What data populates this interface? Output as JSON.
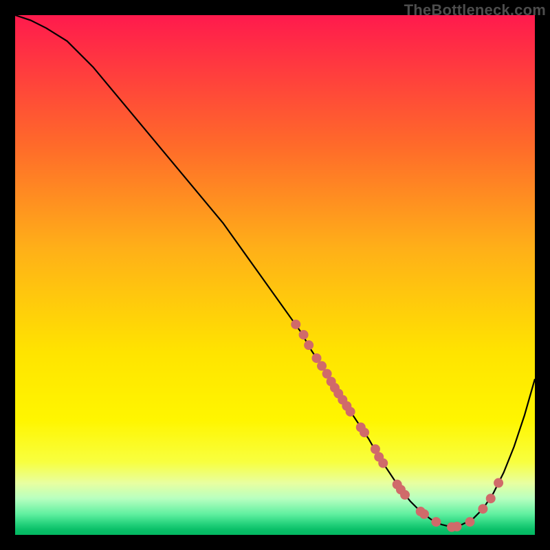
{
  "watermark": "TheBottleneck.com",
  "chart_data": {
    "type": "line",
    "title": "",
    "xlabel": "",
    "ylabel": "",
    "xlim": [
      0,
      100
    ],
    "ylim": [
      0,
      100
    ],
    "grid": false,
    "legend": false,
    "series": [
      {
        "name": "curve",
        "color": "#000000",
        "x": [
          0,
          3,
          6,
          10,
          15,
          20,
          25,
          30,
          35,
          40,
          45,
          50,
          55,
          57,
          60,
          63,
          65,
          68,
          70,
          72,
          74,
          76,
          78,
          80,
          82,
          84,
          86,
          88,
          90,
          92,
          94,
          96,
          98,
          100
        ],
        "values": [
          100,
          99,
          97.5,
          95,
          90,
          84,
          78,
          72,
          66,
          60,
          53,
          46,
          39,
          35.5,
          31,
          26,
          23,
          18.5,
          15,
          12,
          9,
          6.5,
          4.5,
          3,
          2,
          1.5,
          2,
          3,
          5,
          8,
          12,
          17,
          23,
          30
        ]
      }
    ],
    "markers": [
      {
        "name": "dots-on-curve",
        "color": "#d06a6a",
        "radius_px": 7,
        "points": [
          {
            "x": 54,
            "y": 40.5
          },
          {
            "x": 55.5,
            "y": 38.5
          },
          {
            "x": 56.5,
            "y": 36.5
          },
          {
            "x": 58,
            "y": 34
          },
          {
            "x": 59,
            "y": 32.5
          },
          {
            "x": 60,
            "y": 31
          },
          {
            "x": 60.8,
            "y": 29.5
          },
          {
            "x": 61.5,
            "y": 28.3
          },
          {
            "x": 62.2,
            "y": 27.2
          },
          {
            "x": 63,
            "y": 26
          },
          {
            "x": 63.8,
            "y": 24.8
          },
          {
            "x": 64.5,
            "y": 23.7
          },
          {
            "x": 66.5,
            "y": 20.7
          },
          {
            "x": 67.2,
            "y": 19.7
          },
          {
            "x": 69.3,
            "y": 16.5
          },
          {
            "x": 70,
            "y": 15
          },
          {
            "x": 70.8,
            "y": 13.8
          },
          {
            "x": 73.5,
            "y": 9.7
          },
          {
            "x": 74.2,
            "y": 8.7
          },
          {
            "x": 75,
            "y": 7.7
          },
          {
            "x": 78,
            "y": 4.5
          },
          {
            "x": 78.7,
            "y": 4
          },
          {
            "x": 81,
            "y": 2.5
          },
          {
            "x": 84,
            "y": 1.5
          },
          {
            "x": 85,
            "y": 1.6
          },
          {
            "x": 87.5,
            "y": 2.5
          },
          {
            "x": 90,
            "y": 5
          },
          {
            "x": 91.5,
            "y": 7
          },
          {
            "x": 93,
            "y": 10
          }
        ]
      }
    ]
  }
}
